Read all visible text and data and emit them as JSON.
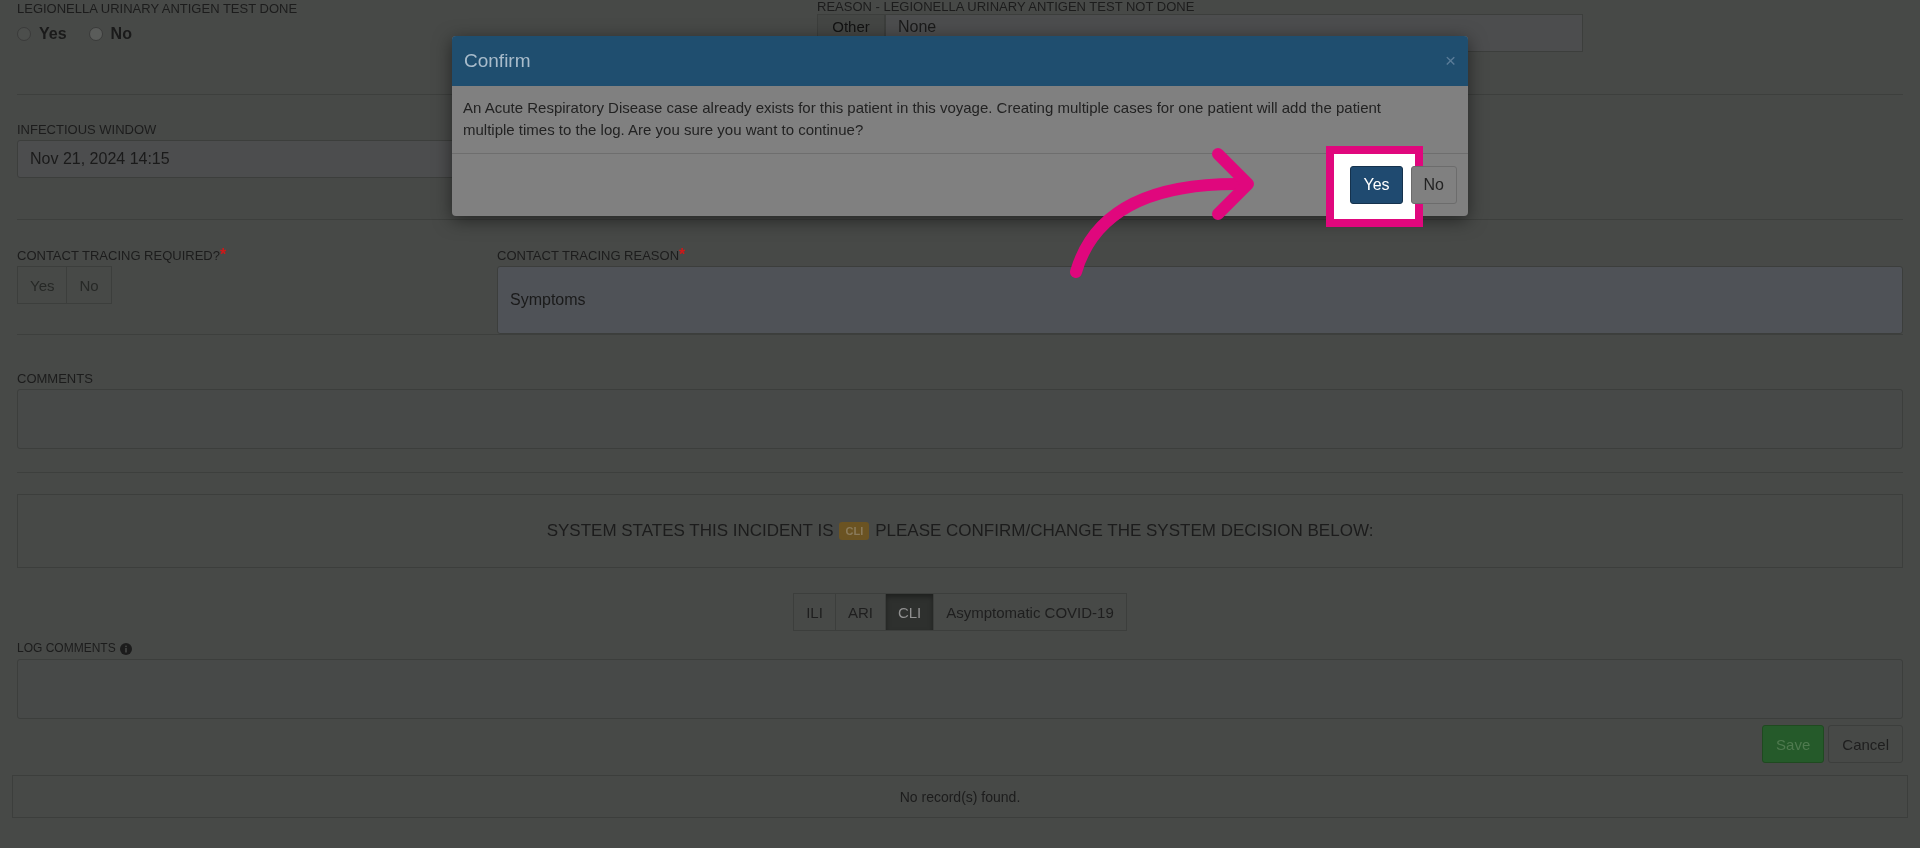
{
  "legionella_test": {
    "label": "LEGIONELLA URINARY ANTIGEN TEST DONE",
    "options": [
      {
        "label": "Yes",
        "selected": false
      },
      {
        "label": "No",
        "selected": true
      }
    ]
  },
  "legionella_reason": {
    "label": "REASON - LEGIONELLA URINARY ANTIGEN TEST NOT DONE",
    "addon": "Other",
    "value": "None"
  },
  "infectious_window": {
    "label": "INFECTIOUS WINDOW",
    "value": "Nov 21, 2024 14:15"
  },
  "contact_tracing_required": {
    "label": "CONTACT TRACING REQUIRED?",
    "required_mark": "*",
    "options": [
      {
        "label": "Yes",
        "selected": false
      },
      {
        "label": "No",
        "selected": false
      }
    ]
  },
  "contact_tracing_reason": {
    "label": "CONTACT TRACING REASON",
    "required_mark": "*",
    "value": "Symptoms"
  },
  "comments": {
    "label": "COMMENTS"
  },
  "system_decision": {
    "before": "SYSTEM STATES THIS INCIDENT IS",
    "badge": "CLI",
    "after": "PLEASE CONFIRM/CHANGE THE SYSTEM DECISION BELOW:"
  },
  "classification": [
    {
      "label": "ILI",
      "selected": false
    },
    {
      "label": "ARI",
      "selected": false
    },
    {
      "label": "CLI",
      "selected": true
    },
    {
      "label": "Asymptomatic COVID-19",
      "selected": false
    }
  ],
  "log_comments": {
    "label": "LOG COMMENTS"
  },
  "form_buttons": [
    {
      "label": "Save",
      "kind": "primary"
    },
    {
      "label": "Cancel",
      "kind": "default"
    }
  ],
  "records": {
    "message": "No record(s) found."
  },
  "dialog": {
    "title": "Confirm",
    "close": "×",
    "message": "An Acute Respiratory Disease case already exists for this patient in this voyage. Creating multiple cases for one patient will add the patient multiple times to the log. Are you sure you want to continue?",
    "buttons": [
      {
        "label": "Yes",
        "kind": "primary",
        "highlighted": true
      },
      {
        "label": "No",
        "kind": "default",
        "highlighted": false
      }
    ]
  }
}
